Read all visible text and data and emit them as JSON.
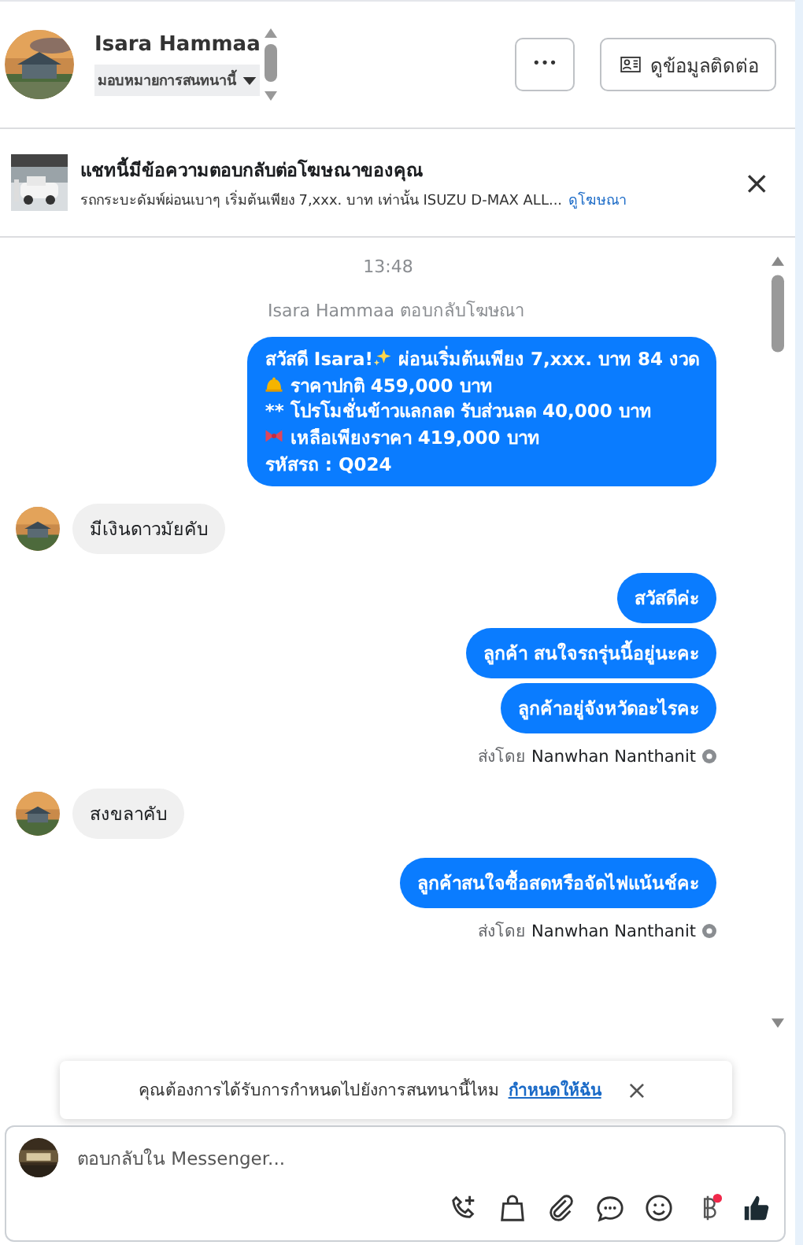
{
  "header": {
    "name": "Isara Hammaa",
    "assign": "มอบหมายการสนทนานี้",
    "more_button": "•••",
    "contact_button": "ดูข้อมูลติดต่อ"
  },
  "ad_banner": {
    "title": "แชทนี้มีข้อความตอบกลับต่อโฆษณาของคุณ",
    "description": "รถกระบะดัมพ์ผ่อนเบาๆ เริ่มต้นเพียง 7,xxx. บาท เท่านั้น ISUZU D-MAX ALL...",
    "link": "ดูโฆษณา",
    "close": "×"
  },
  "messages": [
    {
      "kind": "time",
      "text": "13:48"
    },
    {
      "kind": "note",
      "text": "Isara Hammaa ตอบกลับโฆษณา"
    },
    {
      "kind": "promo",
      "lines": [
        {
          "before": "สวัสดี Isara!",
          "kind": "sparkles",
          "text": "ผ่อนเริ่มต้นเพียง 7,xxx. บาท 84 งวด"
        },
        {
          "kind": "bell",
          "text": "ราคาปกติ 459,000 บาท"
        },
        {
          "text": "** โปรโมชั่นข้าวแลกลด รับส่วนลด 40,000 บาท"
        },
        {
          "kind": "bow",
          "text": "เหลือเพียงราคา 419,000 บาท"
        },
        {
          "text": "รหัสรถ : Q024"
        }
      ]
    },
    {
      "kind": "incoming",
      "text": "มีเงินดาวมัยคับ"
    },
    {
      "kind": "outgoing",
      "text": "สวัสดีค่ะ"
    },
    {
      "kind": "outgoing",
      "text": "ลูกค้า สนใจรถรุ่นนี้อยู่นะคะ"
    },
    {
      "kind": "outgoing",
      "text": "ลูกค้าอยู่จังหวัดอะไรคะ"
    },
    {
      "kind": "sent_by",
      "prefix": "ส่งโดย",
      "name": "Nanwhan Nanthanit"
    },
    {
      "kind": "incoming",
      "text": "สงขลาคับ"
    },
    {
      "kind": "outgoing",
      "text": "ลูกค้าสนใจซื้อสดหรือจัดไฟแน้นช์คะ"
    },
    {
      "kind": "sent_by",
      "prefix": "ส่งโดย",
      "name": "Nanwhan Nanthanit"
    }
  ],
  "toast": {
    "text": "คุณต้องการได้รับการกำหนดไปยังการสนทนานี้ไหม",
    "link": "กำหนดให้ฉัน",
    "close": "×"
  },
  "composer": {
    "placeholder": "ตอบกลับใน Messenger...",
    "baht_notification": true
  }
}
